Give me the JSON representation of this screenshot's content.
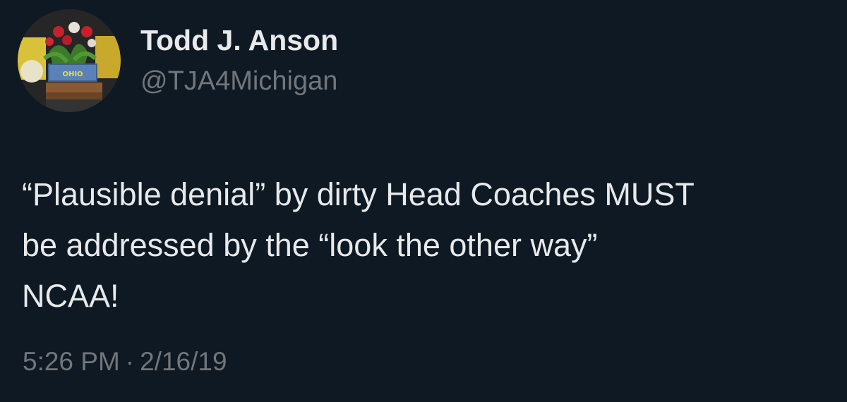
{
  "tweet": {
    "author": {
      "display_name": "Todd J. Anson",
      "handle": "@TJA4Michigan",
      "avatar_label": "OHIO"
    },
    "text_lines": [
      "“Plausible denial” by dirty Head Coaches MUST",
      "be addressed by the “look the other way”",
      "NCAA!"
    ],
    "time": "5:26 PM",
    "separator": "·",
    "date": "2/16/19"
  },
  "colors": {
    "background": "#0f1923",
    "primary_text": "#e7e9ea",
    "secondary_text": "#71767b"
  }
}
